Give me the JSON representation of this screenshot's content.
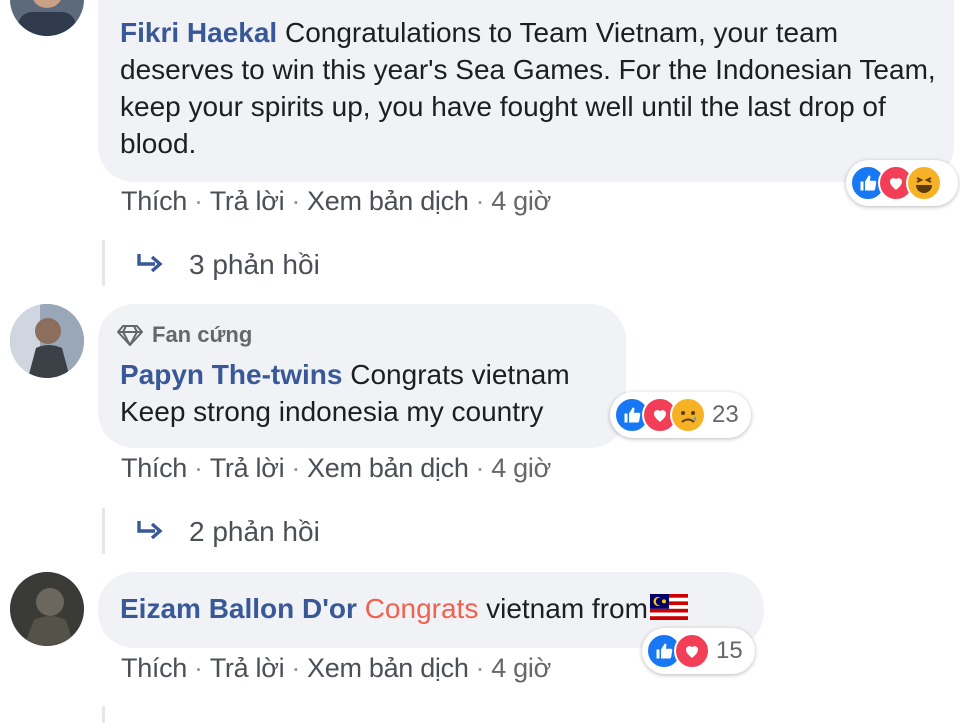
{
  "comments": [
    {
      "author": "Fikri Haekal",
      "text": "Congratulations to Team Vietnam, your team deserves to win this year's Sea Games. For the Indonesian Team, keep your spirits up, you have fought well until the last drop of blood.",
      "actions": {
        "like": "Thích",
        "reply": "Trả lời",
        "translate": "Xem bản dịch",
        "time": "4 giờ"
      },
      "reactions": [
        "like",
        "love",
        "haha"
      ],
      "reaction_count": "",
      "replies": "3 phản hồi"
    },
    {
      "badge": "Fan cứng",
      "author": "Papyn The-twins",
      "text_line1": "Congrats vietnam",
      "text_line2": "Keep strong indonesia my country",
      "actions": {
        "like": "Thích",
        "reply": "Trả lời",
        "translate": "Xem bản dịch",
        "time": "4 giờ"
      },
      "reactions": [
        "like",
        "love",
        "sad"
      ],
      "reaction_count": "23",
      "replies": "2 phản hồi"
    },
    {
      "author": "Eizam Ballon D'or",
      "text_accent": "Congrats",
      "text_rest": "vietnam from",
      "flag": "malaysia-flag",
      "actions": {
        "like": "Thích",
        "reply": "Trả lời",
        "translate": "Xem bản dịch",
        "time": "4 giờ"
      },
      "reactions": [
        "like",
        "love"
      ],
      "reaction_count": "15"
    }
  ],
  "colors": {
    "author": "#385898",
    "bubble": "#f0f2f5",
    "accent": "#f0614f",
    "like": "#1877f2",
    "love": "#f33e58",
    "haha": "#f7b125"
  }
}
